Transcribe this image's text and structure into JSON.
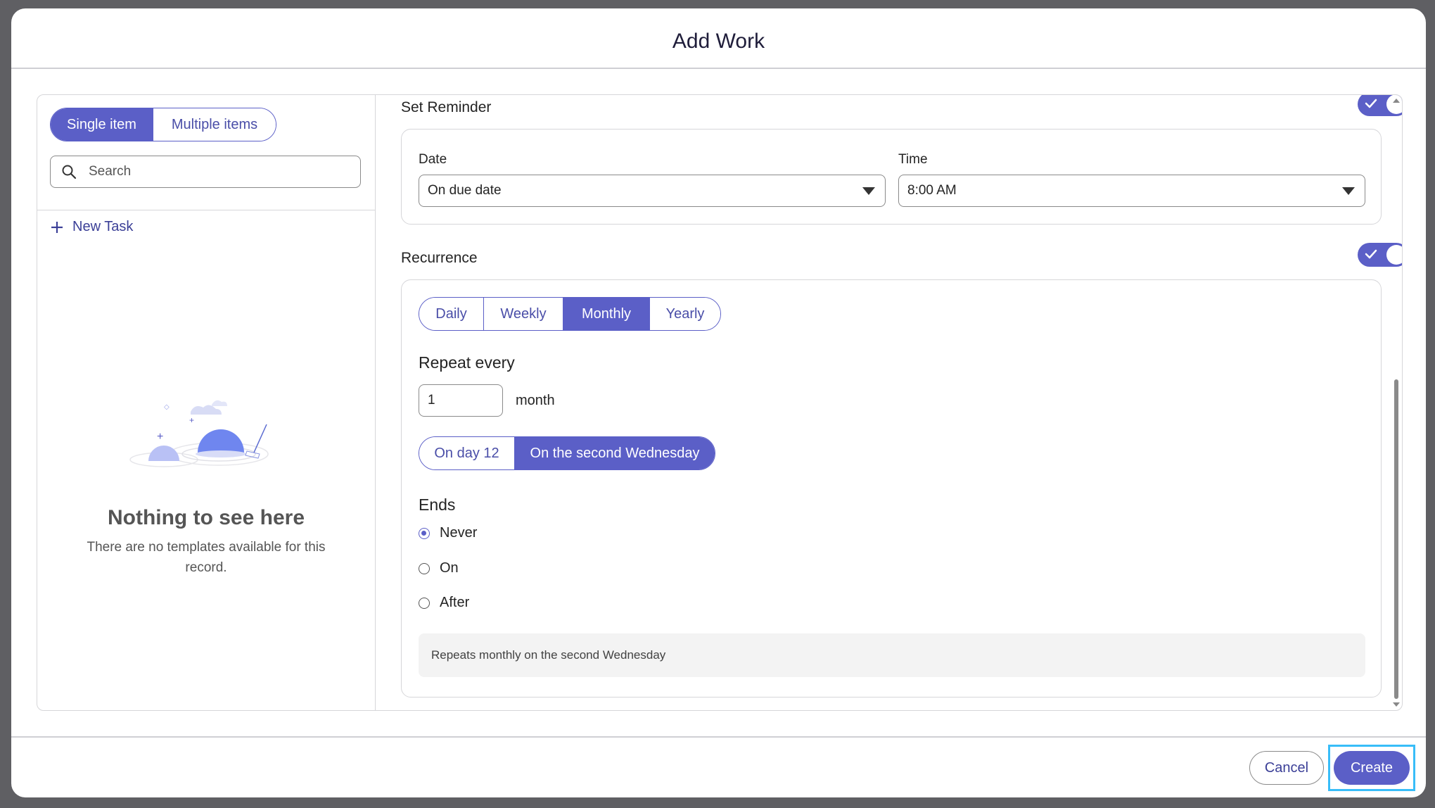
{
  "dialog": {
    "title": "Add Work"
  },
  "left_panel": {
    "mode_tabs": [
      {
        "label": "Single item",
        "active": true
      },
      {
        "label": "Multiple items",
        "active": false
      }
    ],
    "search": {
      "placeholder": "Search",
      "value": ""
    },
    "new_task_label": "New Task",
    "empty_state": {
      "title": "Nothing to see here",
      "subtitle": "There are no templates available for this record."
    }
  },
  "reminder": {
    "label": "Set Reminder",
    "enabled": true,
    "date_label": "Date",
    "date_value": "On due date",
    "time_label": "Time",
    "time_value": "8:00 AM"
  },
  "recurrence": {
    "label": "Recurrence",
    "enabled": true,
    "frequency_tabs": [
      {
        "label": "Daily",
        "active": false
      },
      {
        "label": "Weekly",
        "active": false
      },
      {
        "label": "Monthly",
        "active": true
      },
      {
        "label": "Yearly",
        "active": false
      }
    ],
    "repeat_every_label": "Repeat every",
    "repeat_every_value": "1",
    "repeat_unit": "month",
    "day_options": [
      {
        "label": "On day 12",
        "active": false
      },
      {
        "label": "On the second Wednesday",
        "active": true
      }
    ],
    "ends_label": "Ends",
    "ends_options": [
      {
        "label": "Never",
        "checked": true
      },
      {
        "label": "On",
        "checked": false
      },
      {
        "label": "After",
        "checked": false
      }
    ],
    "summary": "Repeats monthly on the second Wednesday"
  },
  "footer": {
    "cancel_label": "Cancel",
    "create_label": "Create"
  },
  "colors": {
    "accent": "#5b5fc7",
    "accent_text": "#3b3f97",
    "focus_ring": "#38bdf8"
  }
}
